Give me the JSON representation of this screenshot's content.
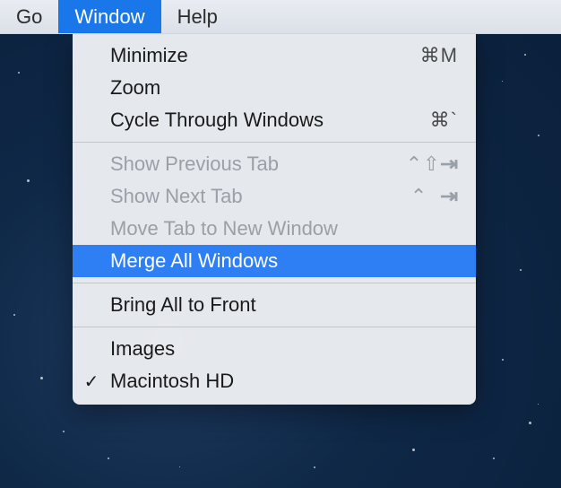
{
  "menubar": {
    "go": "Go",
    "window": "Window",
    "help": "Help"
  },
  "menu": {
    "minimize": {
      "label": "Minimize",
      "shortcut": "⌘M"
    },
    "zoom": {
      "label": "Zoom",
      "shortcut": ""
    },
    "cycle": {
      "label": "Cycle Through Windows",
      "shortcut": "⌘`"
    },
    "show_prev_tab": {
      "label": "Show Previous Tab",
      "shortcut": "⌃⇧⇥"
    },
    "show_next_tab": {
      "label": "Show Next Tab",
      "shortcut": "⌃ ⇥"
    },
    "move_tab": {
      "label": "Move Tab to New Window",
      "shortcut": ""
    },
    "merge_all": {
      "label": "Merge All Windows",
      "shortcut": ""
    },
    "bring_front": {
      "label": "Bring All to Front",
      "shortcut": ""
    },
    "images": {
      "label": "Images",
      "shortcut": ""
    },
    "macintosh_hd": {
      "label": "Macintosh HD",
      "shortcut": "",
      "check": "✓"
    }
  }
}
